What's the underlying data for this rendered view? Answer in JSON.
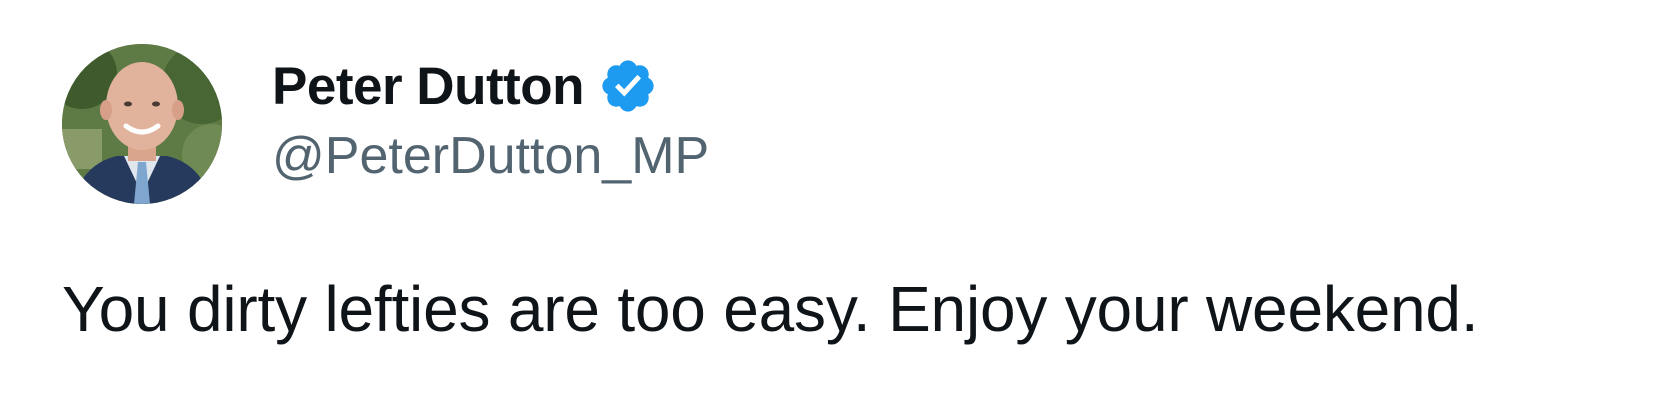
{
  "author": {
    "display_name": "Peter Dutton",
    "handle": "@PeterDutton_MP",
    "verified": true,
    "verified_icon": "verified-badge-icon",
    "verified_color": "#1d9bf0"
  },
  "tweet": {
    "text": "You dirty lefties are too easy. Enjoy your weekend."
  },
  "colors": {
    "text_primary": "#0f1419",
    "text_secondary": "#536471",
    "background": "#ffffff"
  }
}
